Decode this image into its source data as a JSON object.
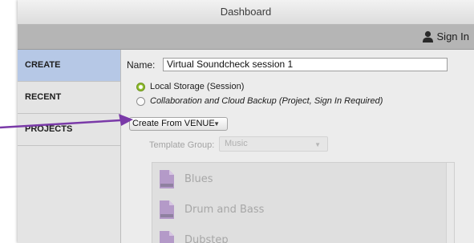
{
  "window": {
    "title": "Dashboard"
  },
  "header": {
    "signin_label": "Sign In",
    "signin_icon": "user-icon"
  },
  "sidebar": {
    "items": [
      {
        "label": "CREATE",
        "active": true
      },
      {
        "label": "RECENT",
        "active": false
      },
      {
        "label": "PROJECTS",
        "active": false
      }
    ]
  },
  "form": {
    "name_label": "Name:",
    "name_value": "Virtual Soundcheck session 1",
    "storage_options": [
      {
        "label": "Local Storage (Session)",
        "selected": true
      },
      {
        "label": "Collaboration and Cloud Backup (Project, Sign In Required)",
        "selected": false
      }
    ],
    "create_from_label": "Create From VENUE",
    "template_group_label": "Template Group:",
    "template_group_value": "Music"
  },
  "templates": [
    {
      "name": "Blues",
      "icon": "template-file-icon"
    },
    {
      "name": "Drum and Bass",
      "icon": "template-file-icon"
    },
    {
      "name": "Dubstep",
      "icon": "template-file-icon"
    }
  ],
  "colors": {
    "sidebar_active": "#b6c8e6",
    "radio_selected": "#8dbb2b",
    "annotation_arrow": "#7a3aa8",
    "template_icon": "#b49ac8"
  }
}
